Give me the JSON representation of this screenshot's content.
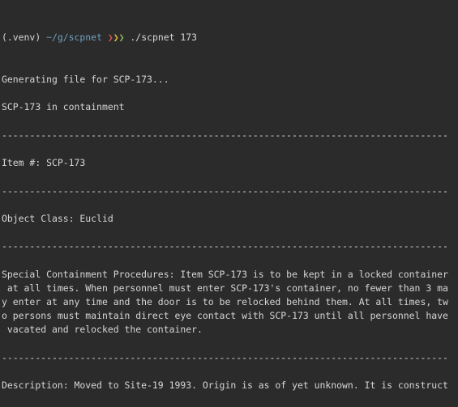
{
  "prompt": {
    "venv": "(.venv)",
    "path": "~/g/scpnet",
    "arrows": [
      "❯",
      "❯",
      "❯"
    ],
    "arrow_colors": [
      "#d9534f",
      "#e8b84a",
      "#8fb560"
    ],
    "command": "./scpnet 173"
  },
  "output": [
    "Generating file for SCP-173...",
    "",
    "SCP-173 in containment",
    "",
    "--------------------------------------------------------------------------------",
    "",
    "Item #: SCP-173",
    "",
    "--------------------------------------------------------------------------------",
    "",
    "Object Class: Euclid",
    "",
    "--------------------------------------------------------------------------------",
    "",
    "Special Containment Procedures: Item SCP-173 is to be kept in a locked container",
    " at all times. When personnel must enter SCP-173's container, no fewer than 3 ma",
    "y enter at any time and the door is to be relocked behind them. At all times, tw",
    "o persons must maintain direct eye contact with SCP-173 until all personnel have",
    " vacated and relocked the container.",
    "",
    "--------------------------------------------------------------------------------",
    "",
    "Description: Moved to Site-19 1993. Origin is as of yet unknown. It is construct"
  ]
}
